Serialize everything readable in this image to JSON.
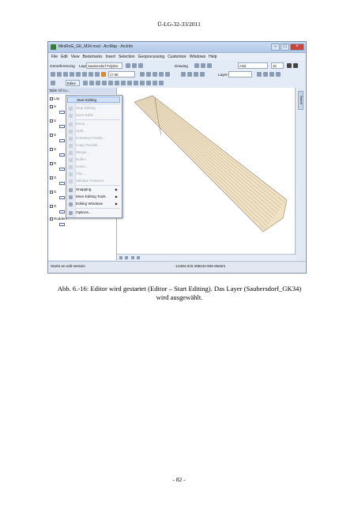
{
  "header": "Ü-LG-32-33/2011",
  "caption": {
    "line1": "Abb. 6.-16: Editor wird gestartet (Editor – Start Editing). Das Layer (Saubersdorf_GK34)",
    "line2": "wird ausgewählt."
  },
  "footer": "- 82 -",
  "screenshot": {
    "title": "MiniRoG_GK_M34.mxd - ArcMap - ArcInfo",
    "menubar": [
      "File",
      "Edit",
      "View",
      "Bookmarks",
      "Insert",
      "Selection",
      "Geoprocessing",
      "Customize",
      "Windows",
      "Help"
    ],
    "toolbar1": {
      "georef_label": "Georeferencing",
      "layer_label": "Layer:",
      "layer_value": "Saubersdorf Polyline",
      "drawing_label": "Drawing",
      "font_value": "Arial",
      "size_value": "10"
    },
    "toolbar2": {
      "scale_value": "17 68",
      "layer_label": "Layer:"
    },
    "editor_button": "Editor",
    "toc": {
      "title": "Table Of Co...",
      "rows": [
        "Lay",
        "S",
        "S",
        "S",
        "S",
        "R",
        "G",
        "G",
        "G",
        "Rodders"
      ]
    },
    "editor_menu": {
      "items": [
        {
          "label": "Start Editing",
          "state": "highlight"
        },
        {
          "label": "Stop Editing",
          "state": "disabled"
        },
        {
          "label": "Save Edits",
          "state": "disabled"
        },
        {
          "label": "Move...",
          "state": "disabled"
        },
        {
          "label": "Split...",
          "state": "disabled"
        },
        {
          "label": "Construct Points...",
          "state": "disabled"
        },
        {
          "label": "Copy Parallel...",
          "state": "disabled"
        },
        {
          "label": "Merge...",
          "state": "disabled"
        },
        {
          "label": "Buffer...",
          "state": "disabled"
        },
        {
          "label": "Union...",
          "state": "disabled"
        },
        {
          "label": "Clip...",
          "state": "disabled"
        },
        {
          "label": "Validate Features",
          "state": "disabled"
        },
        {
          "label": "Snapping",
          "state": "submenu"
        },
        {
          "label": "More Editing Tools",
          "state": "submenu"
        },
        {
          "label": "Editing Windows",
          "state": "submenu"
        },
        {
          "label": "Options...",
          "state": "normal"
        }
      ]
    },
    "right_tab": "Search",
    "status_left": "Starts an edit session",
    "status_right": "-14484.015  295242.935 Meters"
  },
  "colors": {
    "polygon_fill": "#f2e2c4",
    "polygon_line": "#8c7f6a",
    "menu_highlight": "#cfe0f7"
  }
}
